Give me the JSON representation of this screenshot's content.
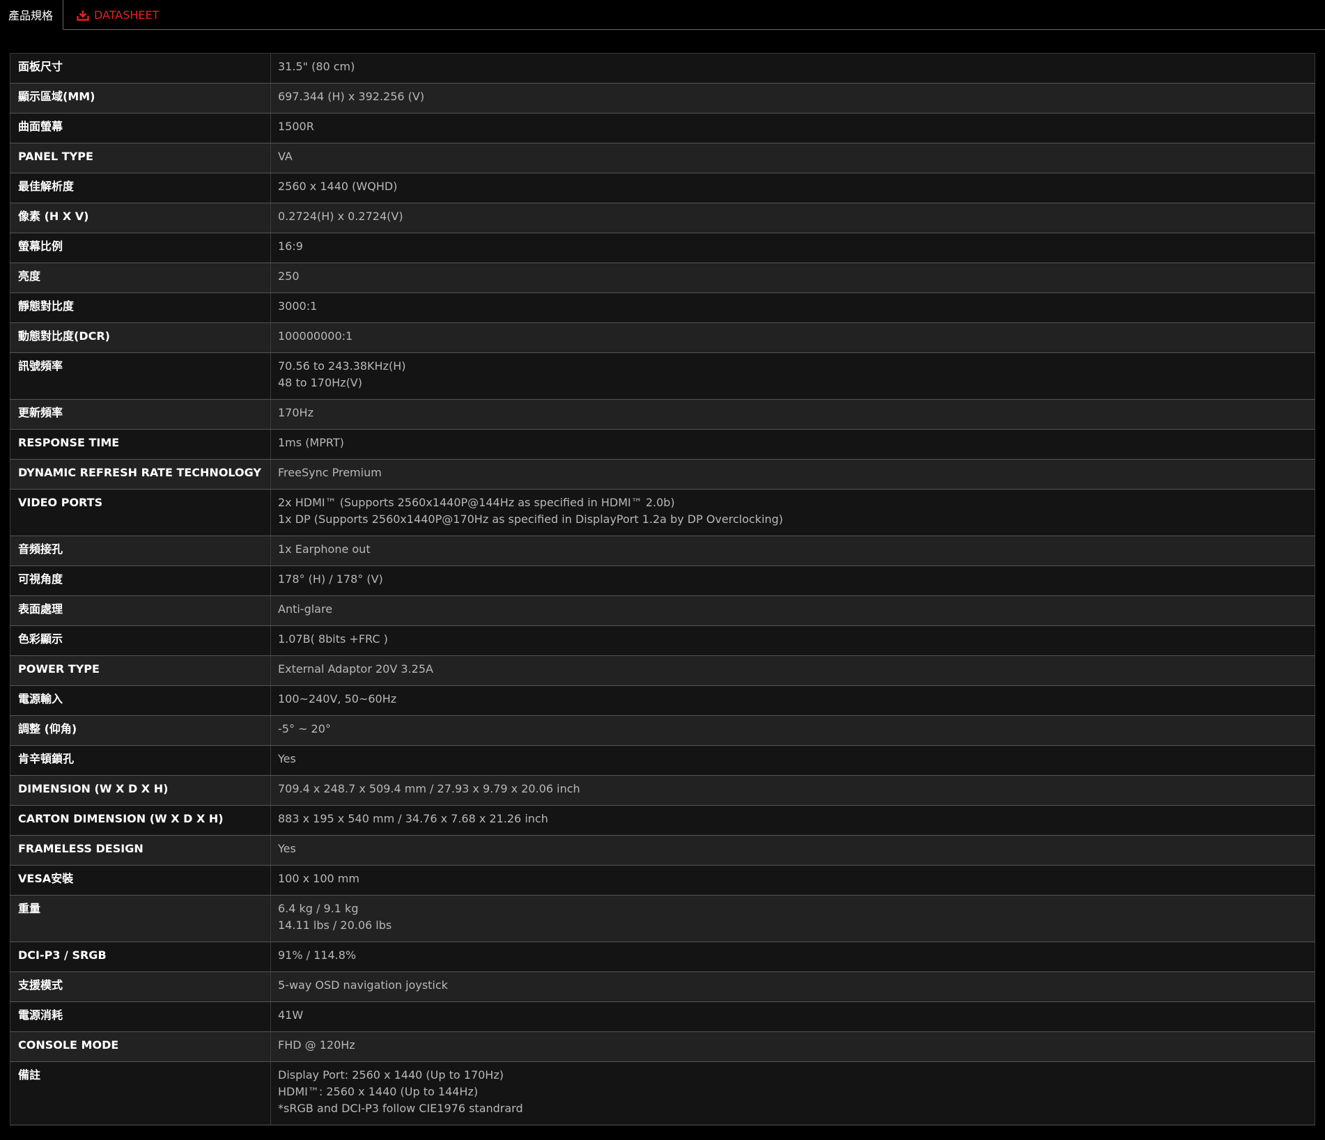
{
  "tabs": {
    "active_label": "產品規格",
    "datasheet_label": "DATASHEET",
    "datasheet_icon": "download-icon",
    "accent_color": "#e8201e"
  },
  "specs": [
    {
      "label": "面板尺寸",
      "value": [
        "31.5\" (80 cm)"
      ]
    },
    {
      "label": "顯示區域(MM)",
      "value": [
        "697.344 (H) x 392.256 (V)"
      ]
    },
    {
      "label": "曲面螢幕",
      "value": [
        "1500R"
      ]
    },
    {
      "label": "PANEL TYPE",
      "value": [
        "VA"
      ]
    },
    {
      "label": "最佳解析度",
      "value": [
        "2560 x 1440 (WQHD)"
      ]
    },
    {
      "label": "像素 (H X V)",
      "value": [
        "0.2724(H) x 0.2724(V)"
      ]
    },
    {
      "label": "螢幕比例",
      "value": [
        "16:9"
      ]
    },
    {
      "label": "亮度",
      "value": [
        "250"
      ]
    },
    {
      "label": "靜態對比度",
      "value": [
        "3000:1"
      ]
    },
    {
      "label": "動態對比度(DCR)",
      "value": [
        "100000000:1"
      ]
    },
    {
      "label": "訊號頻率",
      "value": [
        "70.56 to 243.38KHz(H)",
        "48 to 170Hz(V)"
      ]
    },
    {
      "label": "更新頻率",
      "value": [
        "170Hz"
      ]
    },
    {
      "label": "RESPONSE TIME",
      "value": [
        "1ms (MPRT)"
      ]
    },
    {
      "label": "DYNAMIC REFRESH RATE TECHNOLOGY",
      "value": [
        "FreeSync Premium"
      ]
    },
    {
      "label": "VIDEO PORTS",
      "value": [
        "2x HDMI™ (Supports 2560x1440P@144Hz as specified in HDMI™ 2.0b)",
        "1x DP (Supports 2560x1440P@170Hz as specified in DisplayPort 1.2a by DP Overclocking)"
      ]
    },
    {
      "label": "音頻接孔",
      "value": [
        "1x Earphone out"
      ]
    },
    {
      "label": "可視角度",
      "value": [
        "178° (H) / 178° (V)"
      ]
    },
    {
      "label": "表面處理",
      "value": [
        "Anti-glare"
      ]
    },
    {
      "label": "色彩顯示",
      "value": [
        "1.07B( 8bits +FRC )"
      ]
    },
    {
      "label": "POWER TYPE",
      "value": [
        "External Adaptor 20V 3.25A"
      ]
    },
    {
      "label": "電源輸入",
      "value": [
        "100~240V, 50~60Hz"
      ]
    },
    {
      "label": "調整 (仰角)",
      "value": [
        "-5° ~ 20°"
      ]
    },
    {
      "label": "肯辛頓鎖孔",
      "value": [
        "Yes"
      ]
    },
    {
      "label": "DIMENSION (W X D X H)",
      "value": [
        "709.4 x 248.7 x 509.4 mm / 27.93 x 9.79 x 20.06 inch"
      ]
    },
    {
      "label": "CARTON DIMENSION (W X D X H)",
      "value": [
        "883 x 195 x 540 mm / 34.76 x 7.68 x 21.26 inch"
      ]
    },
    {
      "label": "FRAMELESS DESIGN",
      "value": [
        "Yes"
      ]
    },
    {
      "label": "VESA安裝",
      "value": [
        "100 x 100 mm"
      ]
    },
    {
      "label": "重量",
      "value": [
        "6.4 kg / 9.1 kg",
        "14.11 lbs / 20.06 lbs"
      ]
    },
    {
      "label": "DCI-P3 / SRGB",
      "value": [
        "91% / 114.8%"
      ]
    },
    {
      "label": "支援模式",
      "value": [
        "5-way OSD navigation joystick"
      ]
    },
    {
      "label": "電源消耗",
      "value": [
        "41W"
      ]
    },
    {
      "label": "CONSOLE MODE",
      "value": [
        "FHD @ 120Hz"
      ]
    },
    {
      "label": "備註",
      "value": [
        "Display Port: 2560 x 1440 (Up to 170Hz)",
        "HDMI™: 2560 x 1440 (Up to 144Hz)",
        "*sRGB and DCI-P3 follow CIE1976 standrard"
      ]
    }
  ]
}
